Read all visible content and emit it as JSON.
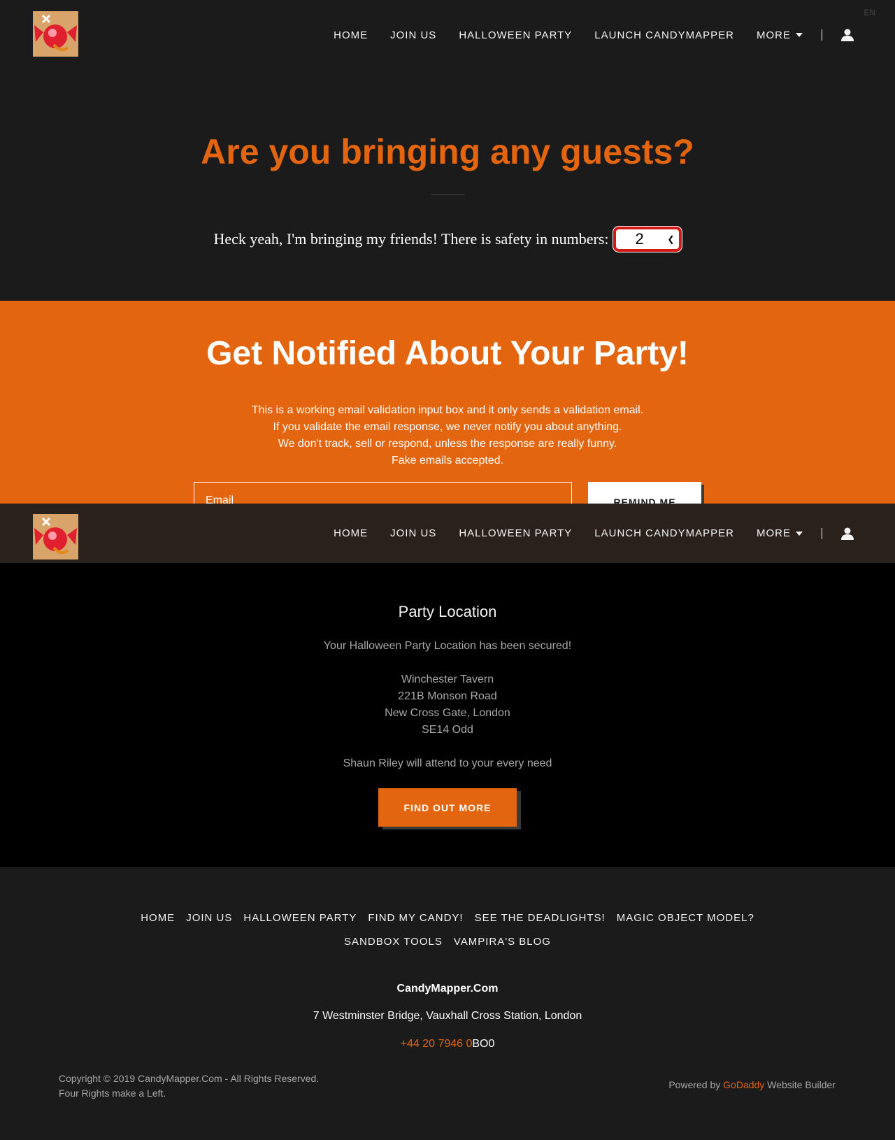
{
  "header": {
    "nav": [
      "HOME",
      "JOIN US",
      "HALLOWEEN PARTY",
      "LAUNCH CANDYMAPPER"
    ],
    "more_label": "MORE",
    "lang": "EN"
  },
  "guests": {
    "title": "Are you bringing any guests?",
    "prompt": "Heck yeah, I'm bringing my friends! There is safety in numbers:",
    "select_value": "2"
  },
  "notify": {
    "title": "Get Notified About Your Party!",
    "lines": [
      "This is a working email validation input box and it only sends a validation email.",
      "If you validate the email response, we never notify you about anything.",
      "We don't track, sell or respond, unless the response are really funny.",
      "Fake emails accepted."
    ],
    "email_placeholder": "Email",
    "button": "REMIND ME"
  },
  "sticky_header": {
    "nav": [
      "HOME",
      "JOIN US",
      "HALLOWEEN PARTY",
      "LAUNCH CANDYMAPPER"
    ],
    "more_label": "MORE"
  },
  "location": {
    "title": "Party Location",
    "lines": [
      "Your Halloween Party Location has been secured!",
      "",
      "Winchester Tavern",
      "221B Monson Road",
      "New Cross Gate, London",
      "SE14 Odd",
      "",
      "Shaun Riley will attend to your every need"
    ],
    "button": "FIND OUT MORE"
  },
  "footer": {
    "nav_row1": [
      "HOME",
      "JOIN US",
      "HALLOWEEN PARTY",
      "FIND MY CANDY!",
      "SEE THE DEADLIGHTS!",
      "MAGIC OBJECT MODEL?"
    ],
    "nav_row2": [
      "SANDBOX TOOLS",
      "VAMPIRA'S BLOG"
    ],
    "brand": "CandyMapper.Com",
    "address": "7 Westminster Bridge, Vauxhall Cross Station, London",
    "phone_link": "+44 20 7946 0",
    "phone_rest": "BO0",
    "copyright_line1": "Copyright © 2019 CandyMapper.Com - All Rights Reserved.",
    "copyright_line2": "Four Rights make a Left.",
    "powered_prefix": "Powered by",
    "powered_link": "GoDaddy",
    "powered_suffix": "Website Builder"
  },
  "colors": {
    "accent": "#e4650f",
    "background": "#1b1b1b",
    "location_bg": "#000000",
    "sticky_header_bg": "#2a211c"
  },
  "icons": [
    "candy-logo-icon",
    "chevron-down-icon",
    "account-icon"
  ]
}
